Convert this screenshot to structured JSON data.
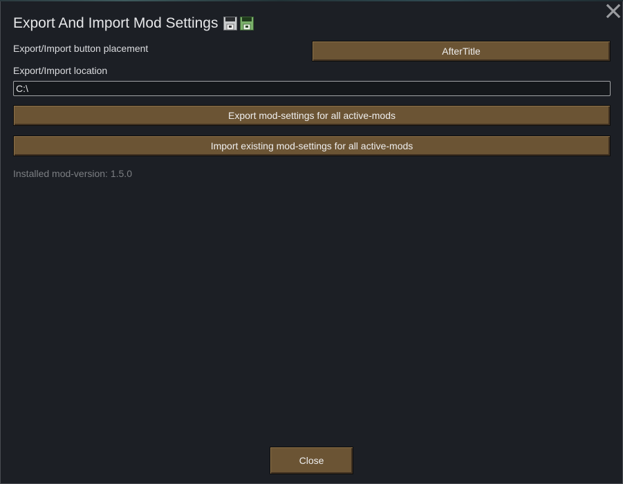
{
  "dialog": {
    "title": "Export And Import Mod Settings",
    "title_icons": [
      "floppy-disk-gray-icon",
      "floppy-disk-green-icon"
    ],
    "close_icon": "close-icon"
  },
  "placement": {
    "label": "Export/Import button placement",
    "value": "AfterTitle"
  },
  "location": {
    "label": "Export/Import location",
    "value": "C:\\"
  },
  "actions": {
    "export_label": "Export mod-settings for all active-mods",
    "import_label": "Import existing mod-settings for all active-mods"
  },
  "version_text": "Installed mod-version: 1.5.0",
  "footer": {
    "close_label": "Close"
  },
  "colors": {
    "background": "#1c1f25",
    "button": "#6b5434",
    "muted_text": "#7c7f83"
  }
}
